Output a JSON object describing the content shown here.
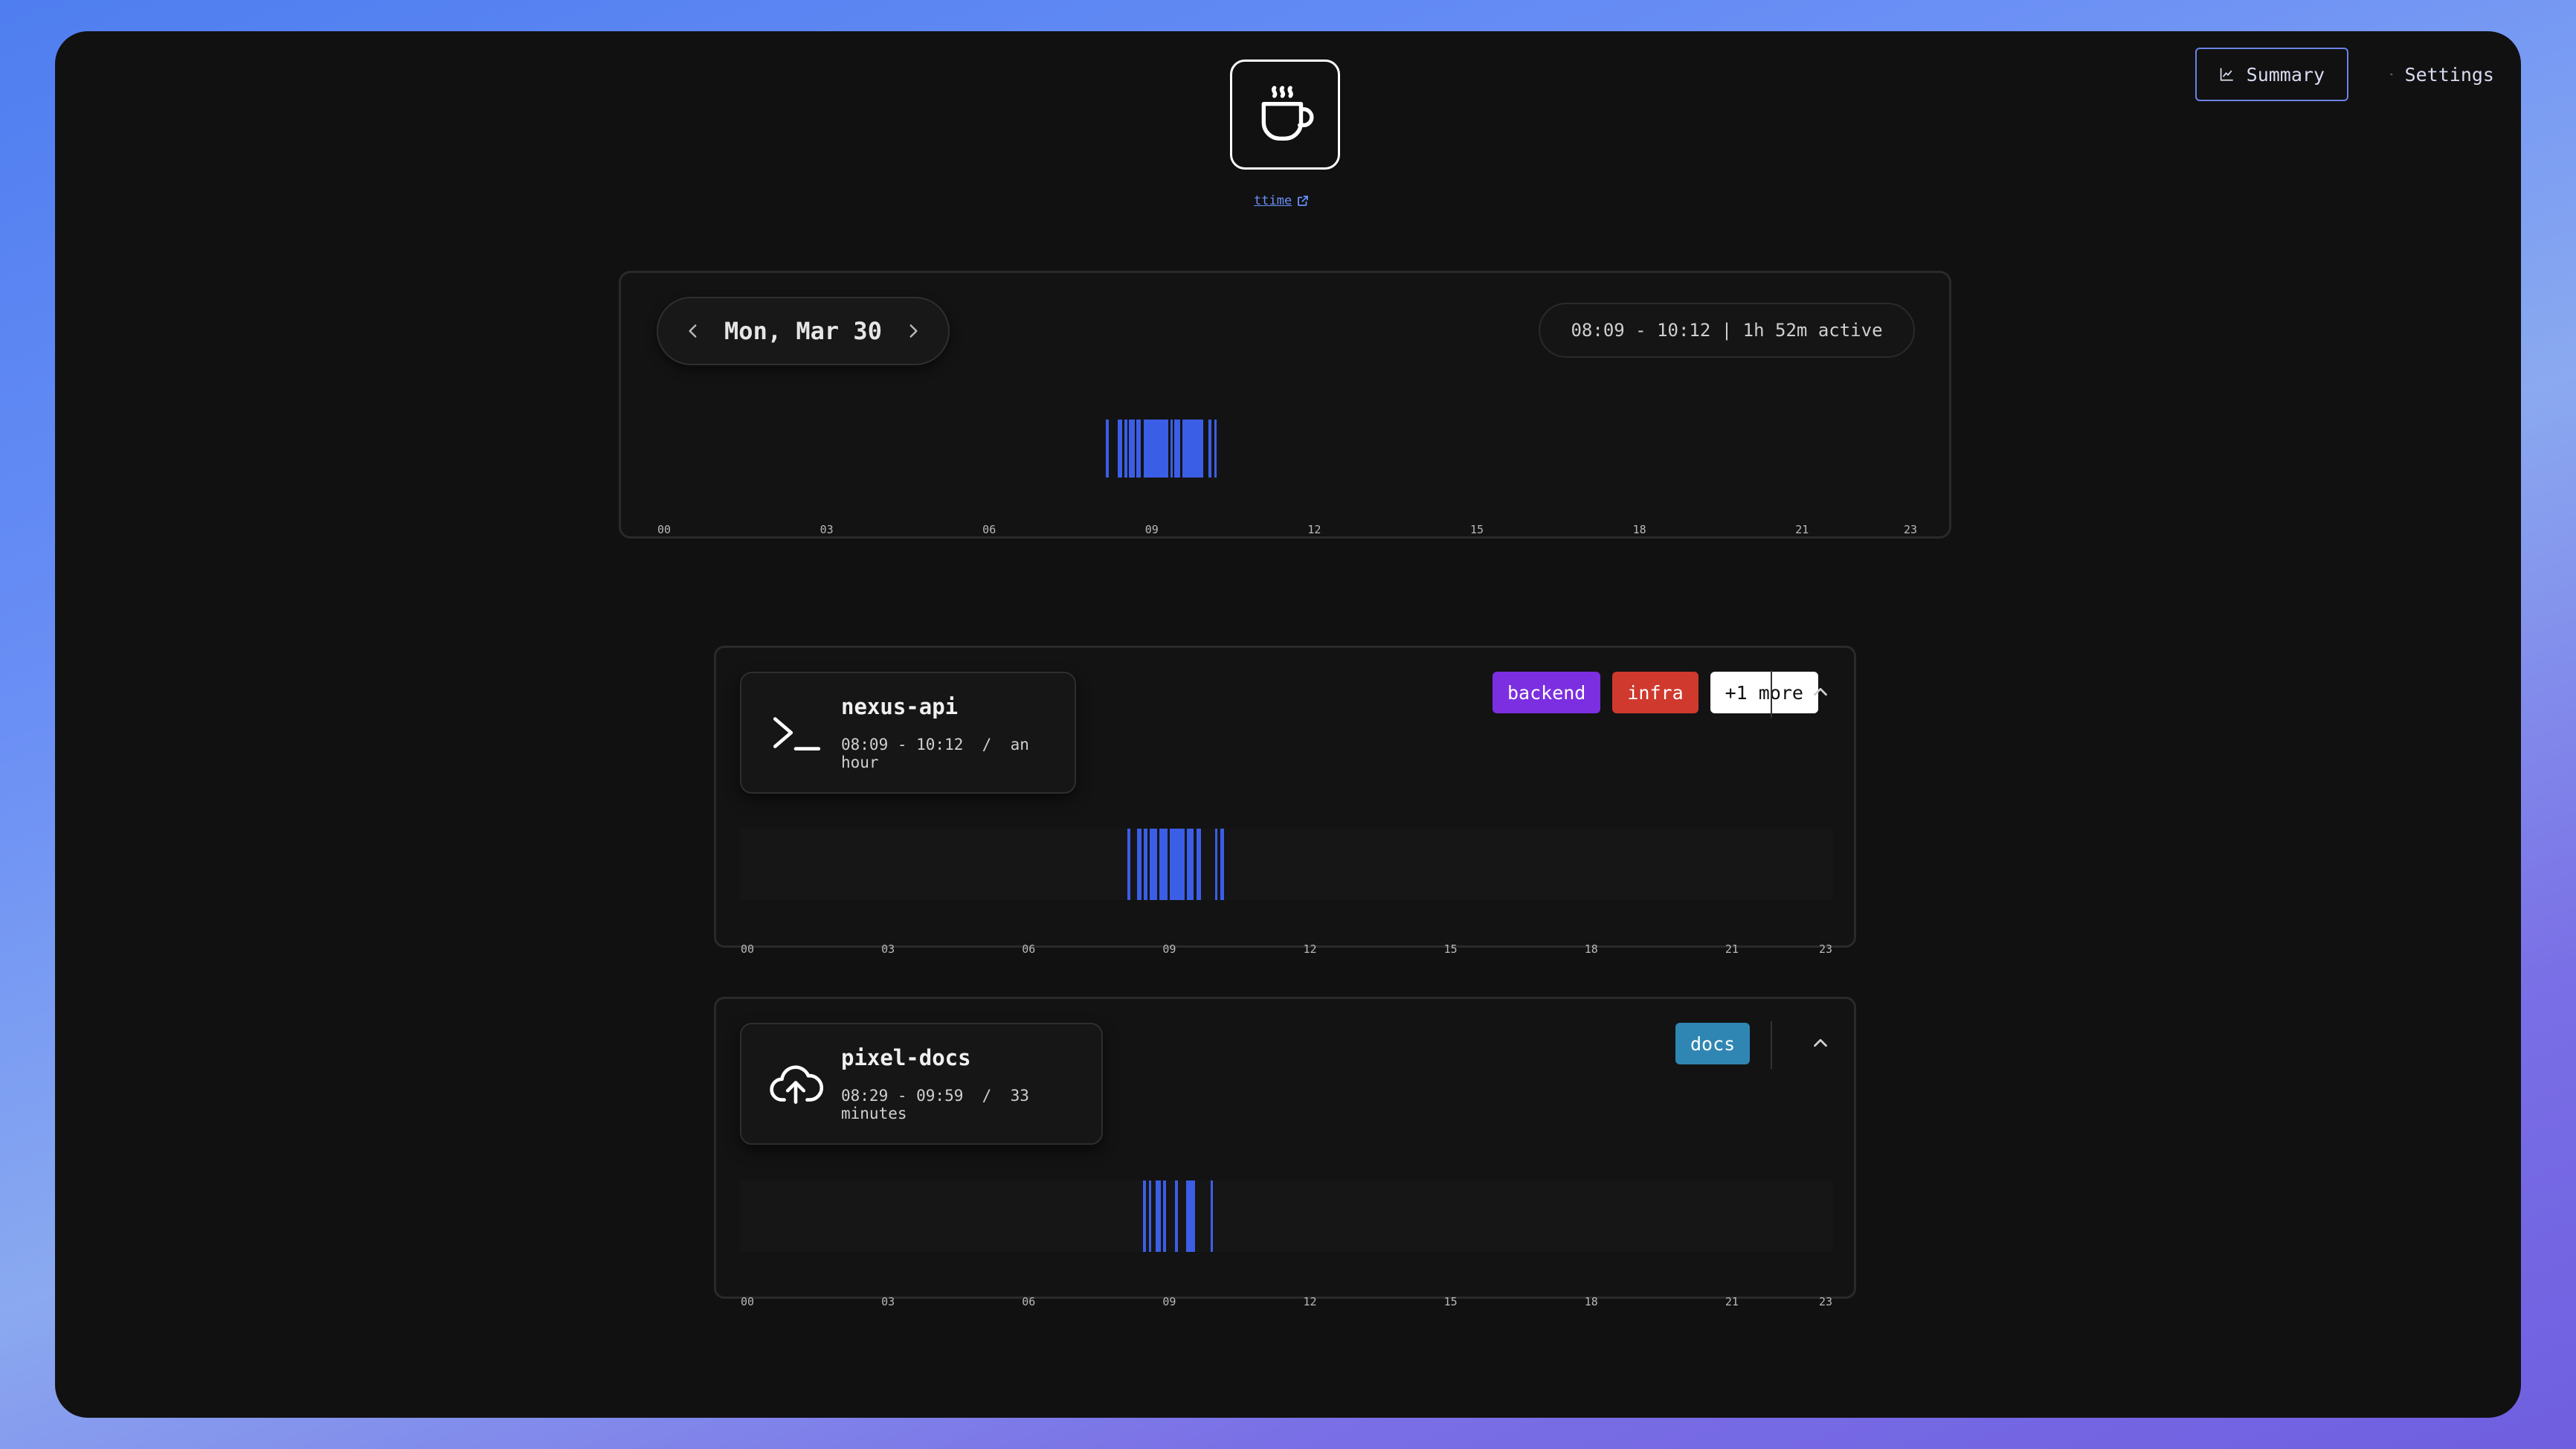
{
  "topbar": {
    "summary_label": "Summary",
    "settings_label": "Settings"
  },
  "brand": {
    "link_text": "ttime"
  },
  "day": {
    "date_label": "Mon, Mar 30",
    "active_summary": "08:09 - 10:12 | 1h 52m active",
    "hour_ticks": [
      "00",
      "03",
      "06",
      "09",
      "12",
      "15",
      "18",
      "21",
      "23"
    ],
    "activity_blocks": [
      {
        "start": 8.15,
        "end": 8.2
      },
      {
        "start": 8.37,
        "end": 8.45
      },
      {
        "start": 8.5,
        "end": 8.55
      },
      {
        "start": 8.58,
        "end": 8.68
      },
      {
        "start": 8.72,
        "end": 8.8
      },
      {
        "start": 8.85,
        "end": 9.3
      },
      {
        "start": 9.35,
        "end": 9.38
      },
      {
        "start": 9.42,
        "end": 9.52
      },
      {
        "start": 9.57,
        "end": 9.95
      },
      {
        "start": 10.05,
        "end": 10.1
      },
      {
        "start": 10.15,
        "end": 10.2
      }
    ]
  },
  "projects": [
    {
      "name": "nexus-api",
      "range": "08:09 - 10:12",
      "duration": "an hour",
      "icon": "terminal-icon",
      "tags": [
        {
          "label": "backend",
          "color": "#7b2fe0"
        },
        {
          "label": "infra",
          "color": "#d0392e"
        },
        {
          "label": "+1 more",
          "color": "#ffffff",
          "text_color": "#111111"
        }
      ],
      "hour_ticks": [
        "00",
        "03",
        "06",
        "09",
        "12",
        "15",
        "18",
        "21",
        "23"
      ],
      "activity_blocks": [
        {
          "start": 8.15,
          "end": 8.22
        },
        {
          "start": 8.35,
          "end": 8.45
        },
        {
          "start": 8.5,
          "end": 8.58
        },
        {
          "start": 8.62,
          "end": 8.78
        },
        {
          "start": 8.82,
          "end": 9.0
        },
        {
          "start": 9.05,
          "end": 9.35
        },
        {
          "start": 9.4,
          "end": 9.55
        },
        {
          "start": 9.6,
          "end": 9.7
        },
        {
          "start": 10.0,
          "end": 10.05
        },
        {
          "start": 10.1,
          "end": 10.18
        }
      ]
    },
    {
      "name": "pixel-docs",
      "range": "08:29 - 09:59",
      "duration": "33 minutes",
      "icon": "cloud-upload-icon",
      "tags": [
        {
          "label": "docs",
          "color": "#2f86b3"
        }
      ],
      "hour_ticks": [
        "00",
        "03",
        "06",
        "09",
        "12",
        "15",
        "18",
        "21",
        "23"
      ],
      "activity_blocks": [
        {
          "start": 8.48,
          "end": 8.55
        },
        {
          "start": 8.6,
          "end": 8.66
        },
        {
          "start": 8.75,
          "end": 8.85
        },
        {
          "start": 8.9,
          "end": 8.96
        },
        {
          "start": 9.15,
          "end": 9.22
        },
        {
          "start": 9.38,
          "end": 9.58
        },
        {
          "start": 9.9,
          "end": 9.95
        }
      ]
    }
  ]
}
